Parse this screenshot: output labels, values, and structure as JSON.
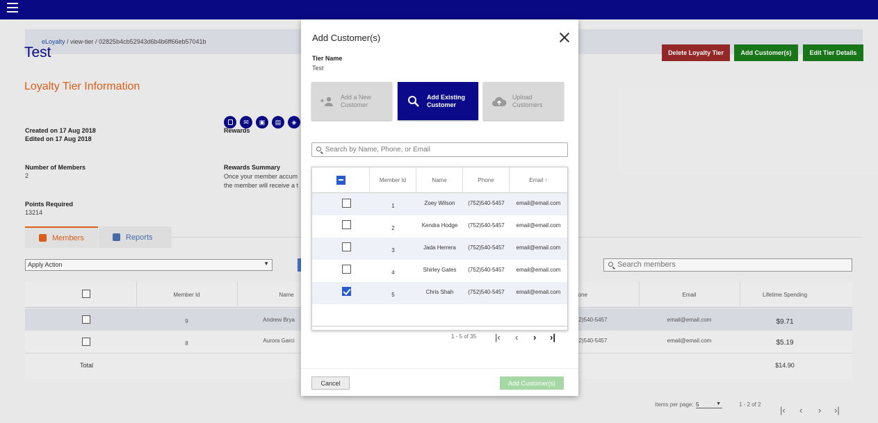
{
  "breadcrumb": {
    "root": "eLoyalty",
    "rest": " / view-tier / 02825b4cb52943d6b4b6ff66eb57041b"
  },
  "page": {
    "title": "Test",
    "section_title": "Loyalty Tier Information"
  },
  "header_buttons": {
    "delete": "Delete Loyalty Tier",
    "add_customers": "Add Customer(s)",
    "edit": "Edit Tier Details"
  },
  "info": {
    "created": "Created on 17 Aug 2018",
    "edited": "Edited on 17 Aug 2018",
    "rewards_label": "Rewards",
    "members_label": "Number of Members",
    "members_value": "2",
    "summary_label": "Rewards Summary",
    "summary_line1": "Once your member accum",
    "summary_line2": "the member will receive a t",
    "points_label": "Points Required",
    "points_value": "13214"
  },
  "tabs": {
    "members": "Members",
    "reports": "Reports"
  },
  "apply_action": "Apply Action",
  "search_members_placeholder": "Search members",
  "members_table": {
    "headers": {
      "member_id": "Member Id",
      "name": "Name",
      "phone": "Phone",
      "email": "Email",
      "lifetime": "Lifetime Spending"
    },
    "rows": [
      {
        "id": "9",
        "name": "Andrew Brya",
        "phone": "2)540-5457",
        "email": "email@email.com",
        "spend": "$9.71"
      },
      {
        "id": "8",
        "name": "Aurora Garci",
        "phone": "2)540-5457",
        "email": "email@email.com",
        "spend": "$5.19"
      }
    ],
    "total_label": "Total",
    "total_value": "$14.90"
  },
  "bottom_pager": {
    "items_per_page_label": "Items per page:",
    "items_per_page": "5",
    "range": "1 - 2 of 2"
  },
  "modal": {
    "title": "Add Customer(s)",
    "tier_name_label": "Tier Name",
    "tier_name_value": "Test",
    "options": {
      "new_line1": "Add a New",
      "new_line2": "Customer",
      "existing_line1": "Add Existing",
      "existing_line2": "Customer",
      "upload_line1": "Upload",
      "upload_line2": "Customers"
    },
    "search_placeholder": "Search by Name, Phone, or Email",
    "table": {
      "headers": {
        "member_id": "Member Id",
        "name": "Name",
        "phone": "Phone",
        "email": "Email",
        "sort_arrow": "↑"
      },
      "rows": [
        {
          "id": "1",
          "name": "Zoey Wilson",
          "phone": "(752)540-5457",
          "email": "email@email.com",
          "checked": false
        },
        {
          "id": "2",
          "name": "Kendra Hodge",
          "phone": "(752)540-5457",
          "email": "email@email.com",
          "checked": false
        },
        {
          "id": "3",
          "name": "Jada Herrera",
          "phone": "(752)540-5457",
          "email": "email@email.com",
          "checked": false
        },
        {
          "id": "4",
          "name": "Shirley Gates",
          "phone": "(752)540-5457",
          "email": "email@email.com",
          "checked": false
        },
        {
          "id": "5",
          "name": "Chris Shah",
          "phone": "(752)540-5457",
          "email": "email@email.com",
          "checked": true
        }
      ]
    },
    "pager": {
      "range": "1 - 5 of 35",
      "first": "|<",
      "prev": "<",
      "next": ">",
      "last": ">|"
    },
    "cancel": "Cancel",
    "add": "Add Customer(s)"
  },
  "colors": {
    "brand": "#0a0a8a",
    "accent": "#e2631b",
    "danger": "#9b2a2a",
    "success": "#1a7a1a",
    "selected": "#2a5ad0"
  }
}
